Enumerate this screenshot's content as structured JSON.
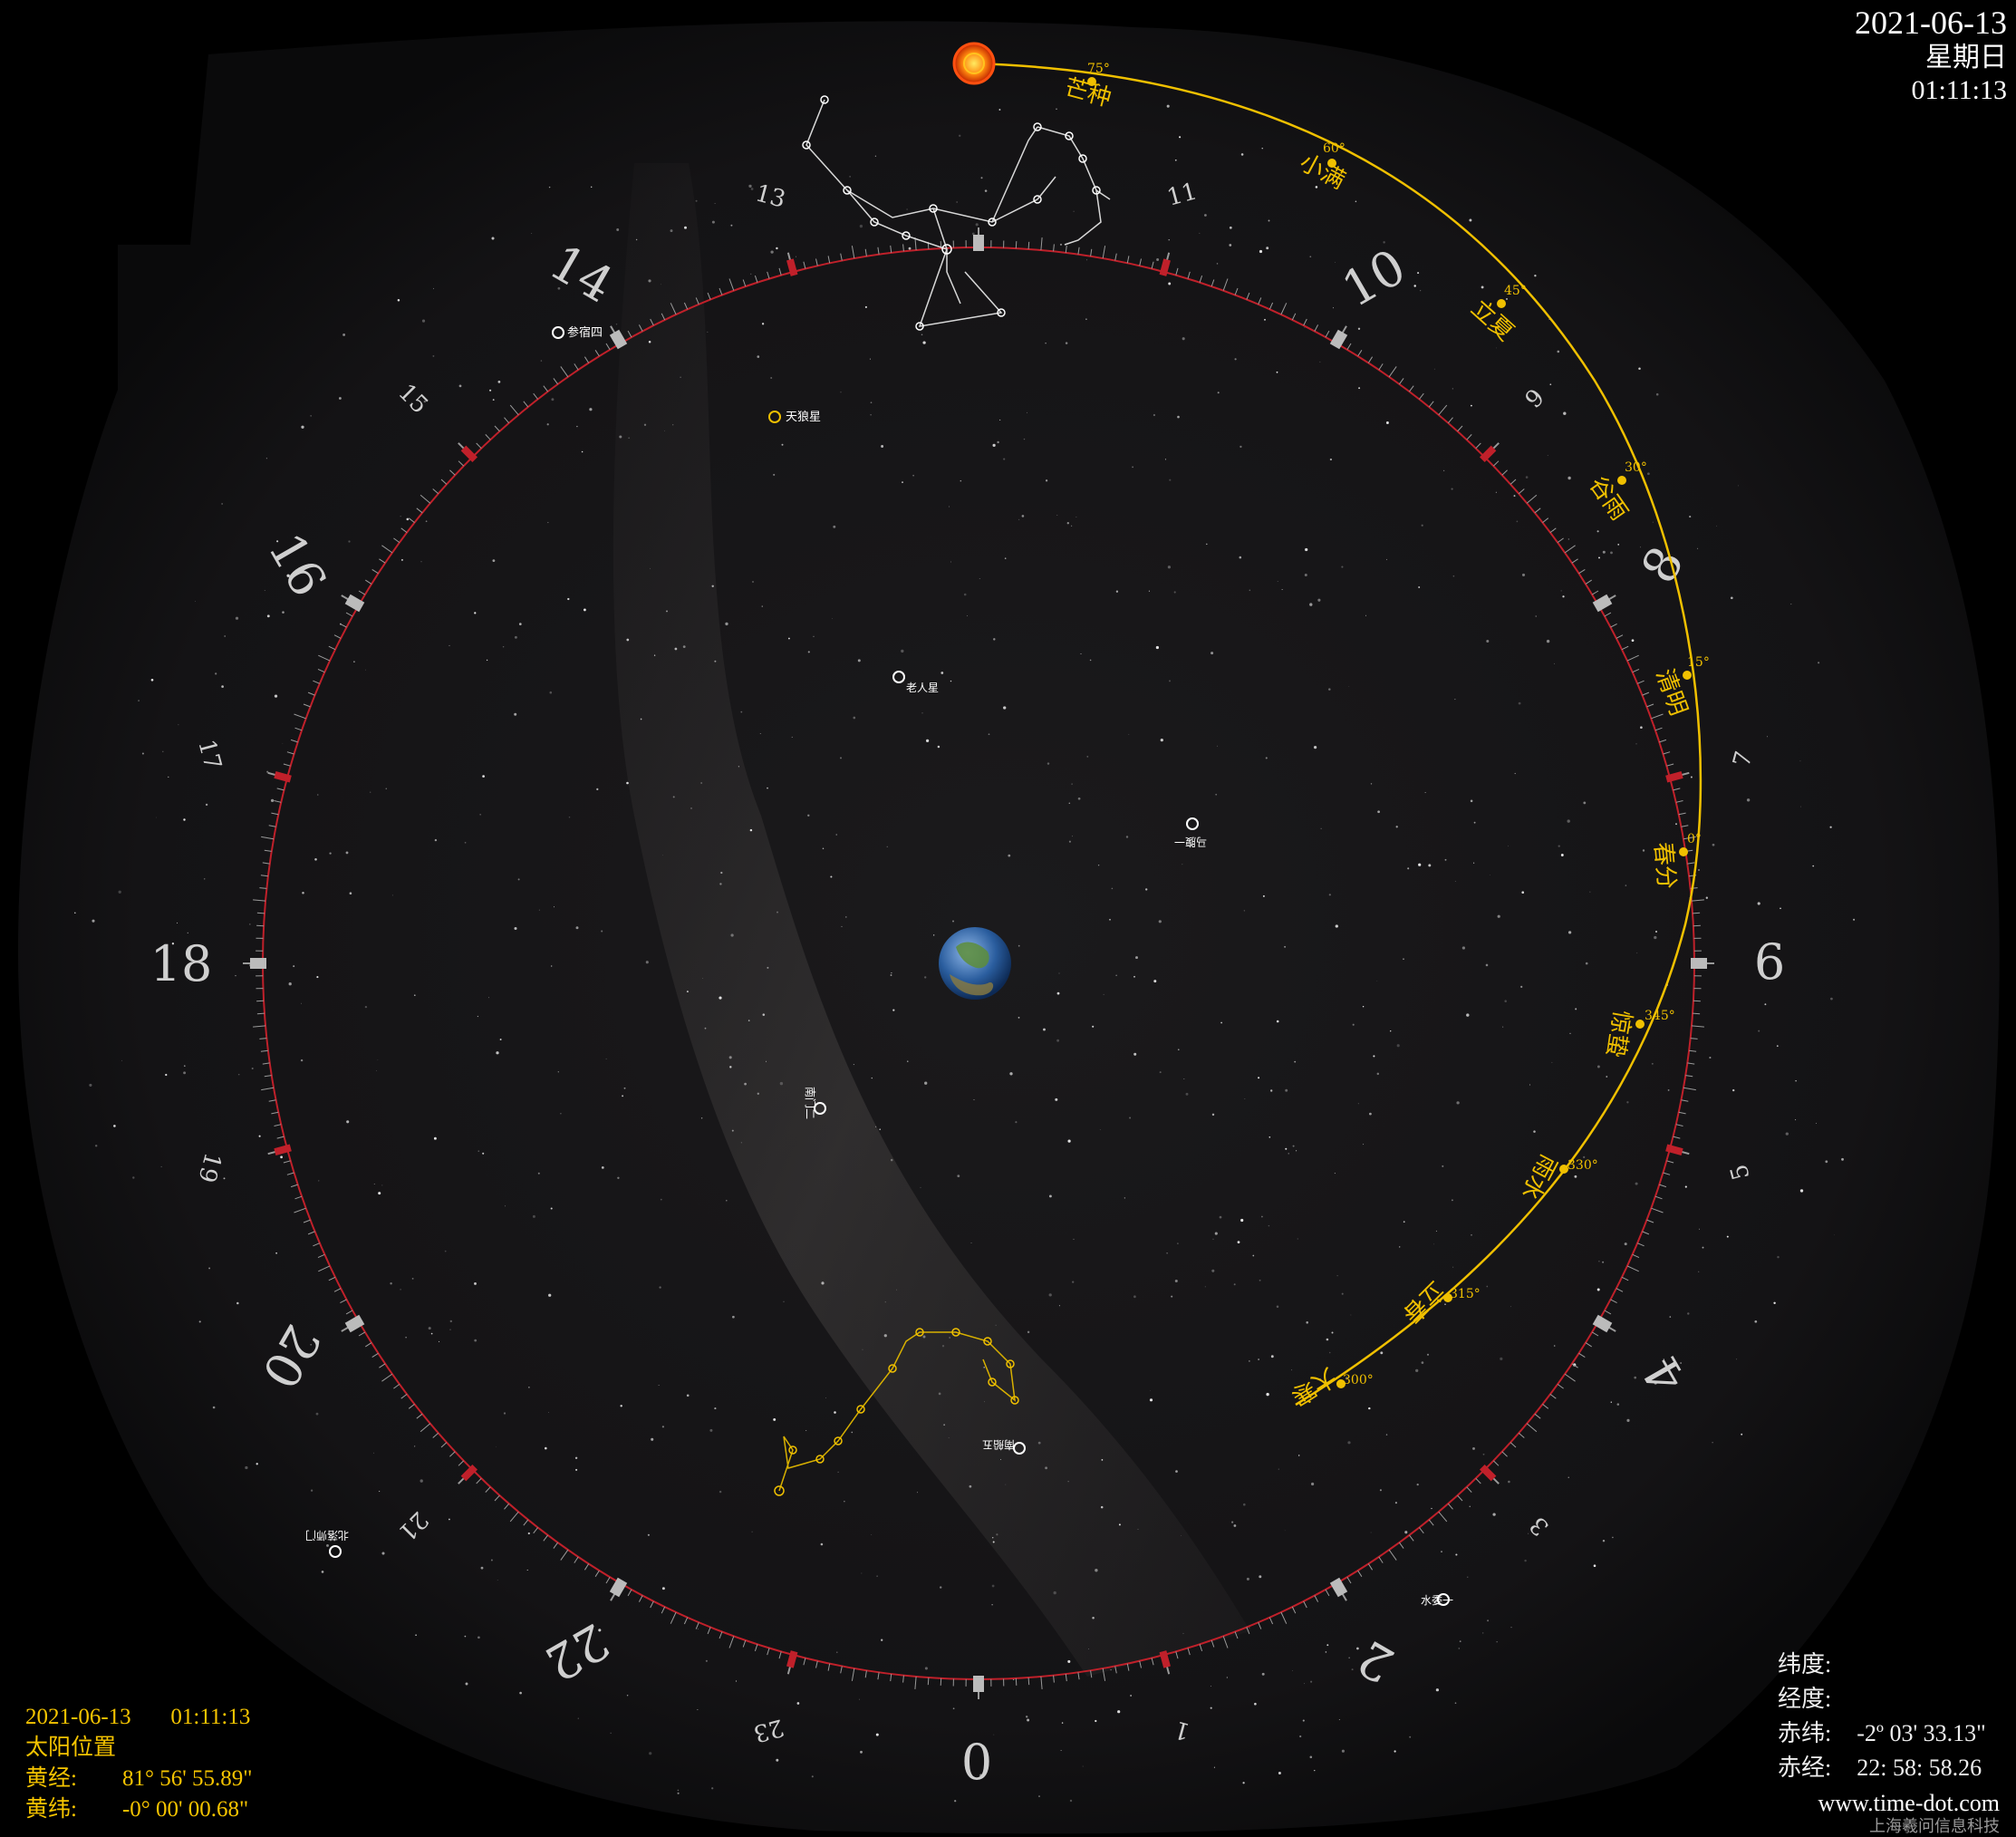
{
  "header": {
    "date": "2021-06-13",
    "weekday": "星期日",
    "time": "01:11:13"
  },
  "sun_info": {
    "datetime": "2021-06-13       01:11:13",
    "title": "太阳位置",
    "lon_label": "黄经:",
    "lon_value": "81° 56' 55.89\"",
    "lat_label": "黄纬:",
    "lat_value": "-0° 00' 00.68\""
  },
  "coords": {
    "lat_label": "纬度:",
    "lon_label": "经度:",
    "dec_label": "赤纬:",
    "dec_value": "-2º 03' 33.13\"",
    "ra_label": "赤经:",
    "ra_value": "22: 58: 58.26"
  },
  "credit": {
    "site": "www.time-dot.com",
    "company": "上海羲问信息科技"
  },
  "hour_labels_large": [
    "0",
    "2",
    "4",
    "6",
    "8",
    "10",
    "14",
    "16",
    "18",
    "20",
    "22"
  ],
  "hour_labels_small": [
    "1",
    "3",
    "5",
    "7",
    "9",
    "11",
    "13",
    "15",
    "17",
    "19",
    "21",
    "23"
  ],
  "solar_terms": [
    {
      "name": "芒种",
      "deg": "75°"
    },
    {
      "name": "小满",
      "deg": "60°"
    },
    {
      "name": "立夏",
      "deg": "45°"
    },
    {
      "name": "谷雨",
      "deg": "30°"
    },
    {
      "name": "清明",
      "deg": "15°"
    },
    {
      "name": "春分",
      "deg": "0°"
    },
    {
      "name": "惊蛰",
      "deg": "345°"
    },
    {
      "name": "雨水",
      "deg": "330°"
    },
    {
      "name": "立春",
      "deg": "315°"
    },
    {
      "name": "大寒",
      "deg": "300°"
    }
  ],
  "star_labels": [
    "天狼星",
    "老人星",
    "南门二",
    "参宿四",
    "马腹一",
    "水委一",
    "北落师门",
    "南船五"
  ],
  "colors": {
    "ecliptic": "#f0c000",
    "dial_ring": "#c0202a",
    "hud_text": "#f5c400",
    "sky": "#101012"
  },
  "icons": {
    "sun": "sun-icon",
    "earth": "earth-icon"
  }
}
